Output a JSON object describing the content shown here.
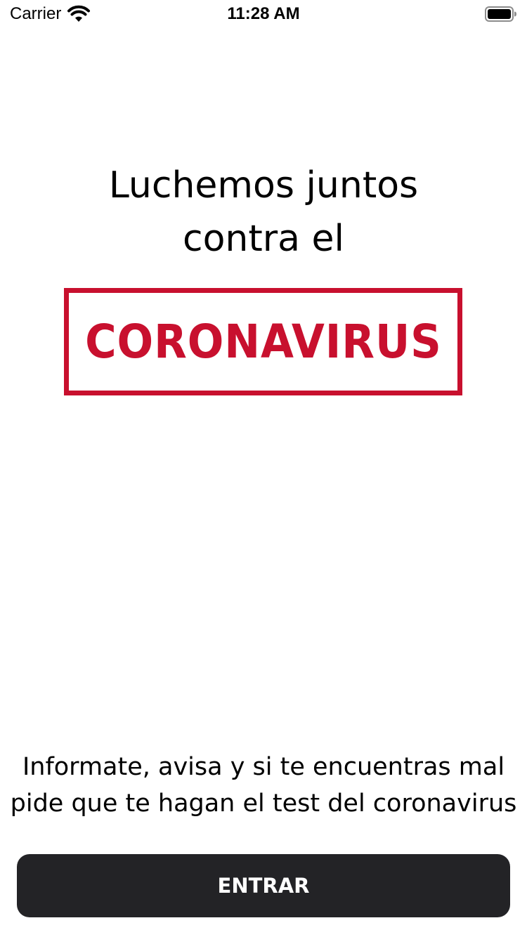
{
  "status_bar": {
    "carrier": "Carrier",
    "time": "11:28 AM",
    "wifi_icon": "wifi-icon",
    "battery_icon": "battery-icon"
  },
  "headline": {
    "line1": "Luchemos juntos",
    "line2": "contra el"
  },
  "logo": {
    "text": "CORONAVIRUS",
    "color": "#c8102e"
  },
  "message": {
    "line1": "Informate, avisa y si te encuentras mal",
    "line2": "pide que te hagan el test del coronavirus"
  },
  "button": {
    "label": "ENTRAR",
    "background": "#232326"
  }
}
